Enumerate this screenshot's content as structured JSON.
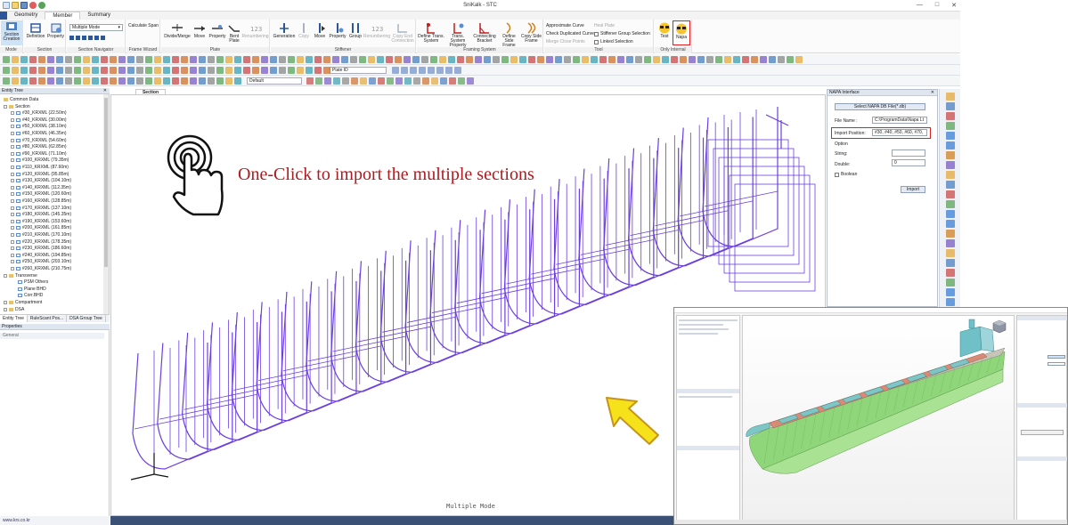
{
  "window": {
    "title": "SniKalk - STC"
  },
  "ribbon_tabs": [
    {
      "label": "Geometry"
    },
    {
      "label": "Member"
    },
    {
      "label": "Summary"
    }
  ],
  "ribbon": {
    "mode_group": {
      "label": "Mode",
      "section_creation": "Section Creation"
    },
    "section_group": {
      "label": "Section",
      "definition": "Definition",
      "property": "Property"
    },
    "navigator_group": {
      "label": "Section Navigator",
      "mode_select": "Multiple Mode"
    },
    "frame_wizard_group": {
      "label": "Frame Wizard",
      "calculate_span": "Calculate Span"
    },
    "plate_group": {
      "label": "Plate",
      "divide_merge": "Divide/Merge",
      "move": "Move",
      "property": "Property",
      "bent_plate": "Bent Plate",
      "renumbering": "Renumbering"
    },
    "stiffener_group": {
      "label": "Stiffener",
      "generation": "Generation",
      "copy": "Copy",
      "move": "Move",
      "property": "Property",
      "group": "Group",
      "renumbering": "Renumbering",
      "copy_end_connection": "Copy End Connection"
    },
    "framing_group": {
      "label": "Framing System",
      "define_trans": "Define Trans. System",
      "trans_property": "Trans. System Property",
      "connecting_bracket": "Connecting Bracket",
      "define_side_frame": "Define Side Frame",
      "copy_side_frame": "Copy Side Frame"
    },
    "tool_group": {
      "label": "Tool",
      "approximate_curve": "Approximate Curve",
      "heal_plate": "Heal Plate",
      "check_duplicated": "Check Duplicated Curve",
      "stiffener_group_selection": "Stiffener Group Selection",
      "merge_close_points": "Merge Close Points",
      "linked_selection": "Linked Selection"
    },
    "internal_group": {
      "label": "Only Internal",
      "test": "Test",
      "napa": "Napa"
    }
  },
  "toolbars": {
    "plate_id_select": "Plate ID",
    "default_select": "Default"
  },
  "entity_tree": {
    "title": "Entity Tree",
    "common_data": "Common Data",
    "section": "Section",
    "section_items": [
      "#30_KRXML (22.50m)",
      "#40_KRXML (30.00m)",
      "#50_KRXML (38.10m)",
      "#60_KRXML (46.35m)",
      "#70_KRXML (54.60m)",
      "#80_KRXML (62.85m)",
      "#90_KRXML (71.10m)",
      "#100_KRXML (79.35m)",
      "#110_KRXML (87.60m)",
      "#120_KRXML (95.85m)",
      "#130_KRXML (104.10m)",
      "#140_KRXML (112.35m)",
      "#150_KRXML (120.60m)",
      "#160_KRXML (128.85m)",
      "#170_KRXML (137.10m)",
      "#180_KRXML (145.35m)",
      "#190_KRXML (153.60m)",
      "#200_KRXML (161.85m)",
      "#210_KRXML (170.10m)",
      "#220_KRXML (178.35m)",
      "#230_KRXML (186.60m)",
      "#240_KRXML (194.85m)",
      "#250_KRXML (203.10m)",
      "#260_KRXML (210.75m)"
    ],
    "transverse": "Transverse",
    "transverse_items": [
      "PSM Others",
      "Plane BHD",
      "Corr.BHD"
    ],
    "compartment": "Compartment",
    "dsa": "DSA"
  },
  "bottom_tabs": [
    "Entity Tree",
    "RuleScant Pos...",
    "DSA Group Tree"
  ],
  "properties": {
    "title": "Properties",
    "general": "General"
  },
  "status": {
    "url": "www.krs.co.kr"
  },
  "viewport": {
    "tab": "Section",
    "mode_label": "Multiple Mode",
    "callout": "One-Click to import the multiple sections"
  },
  "napa_interface": {
    "title": "NAPA Interface",
    "select_button": "Select NAPA DB File(*.db)",
    "file_name_label": "File Name :",
    "file_name_value": "C:\\ProgramData\\Napa Lt",
    "import_position_label": "Import Position:",
    "import_position_value": "#30, #40, #50, #60, #70,",
    "option_label": "Option",
    "string_label": "String:",
    "double_label": "Double:",
    "double_value": "0",
    "boolean_label": "Boolean",
    "import_button": "Import"
  },
  "colors": {
    "accent": "#7c3aed",
    "hull_purple": "#6b3fe0",
    "callout_red": "#b0191e",
    "highlight_red": "#e02020",
    "arrow_yellow": "#f5e21b"
  }
}
